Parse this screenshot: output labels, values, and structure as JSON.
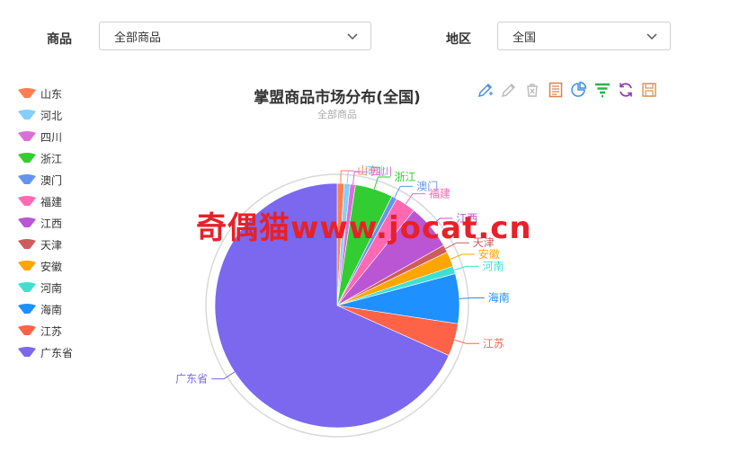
{
  "filters": {
    "product_label": "商品",
    "product_value": "全部商品",
    "region_label": "地区",
    "region_value": "全国"
  },
  "colors": {
    "山东": "#ff7f50",
    "河北": "#87cefa",
    "四川": "#da70d6",
    "浙江": "#32cd32",
    "澳门": "#6495ed",
    "福建": "#ff69b4",
    "江西": "#ba55d3",
    "天津": "#cd5c5c",
    "安徽": "#ffa500",
    "河南": "#40e0d0",
    "海南": "#1e90ff",
    "江苏": "#ff6347",
    "广东省": "#7b68ee"
  },
  "toolbox_icons": [
    "edit-icon",
    "edit-disabled-icon",
    "clear-icon",
    "data-view-icon",
    "pie-switch-icon",
    "funnel-switch-icon",
    "restore-icon",
    "save-image-icon"
  ],
  "watermark": "奇偶猫www.jocat.cn",
  "chart_data": {
    "type": "pie",
    "title": "掌盟商品市场分布(全国)",
    "subtitle": "全部商品",
    "legend_position": "left",
    "categories": [
      "山东",
      "河北",
      "四川",
      "浙江",
      "澳门",
      "福建",
      "江西",
      "天津",
      "安徽",
      "河南",
      "海南",
      "江苏",
      "广东省"
    ],
    "values": [
      0.9,
      0.8,
      0.7,
      5.0,
      0.7,
      2.7,
      6.0,
      1.0,
      2.0,
      1.0,
      6.6,
      4.3,
      68.3
    ]
  }
}
